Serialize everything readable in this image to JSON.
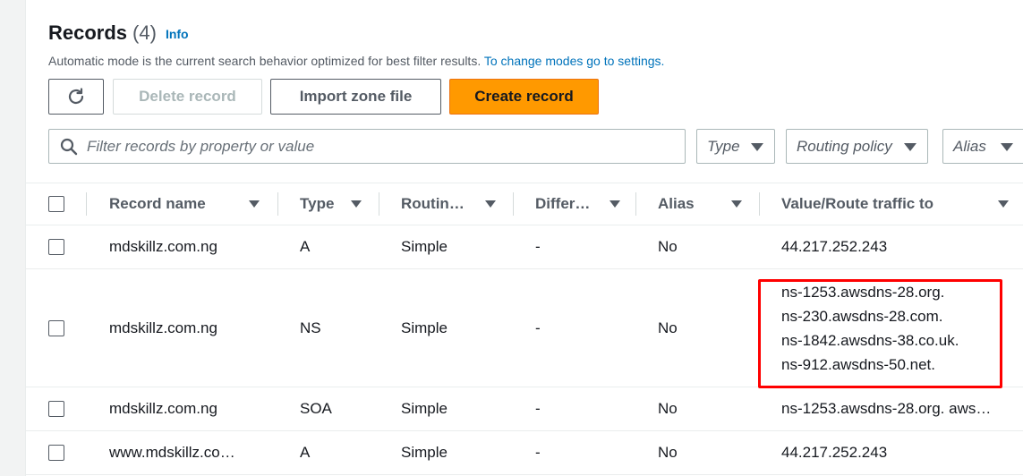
{
  "header": {
    "title": "Records",
    "count": "(4)",
    "info_link": "Info",
    "description": "Automatic mode is the current search behavior optimized for best filter results.",
    "description_link": "To change modes go to settings."
  },
  "toolbar": {
    "delete_label": "Delete record",
    "import_label": "Import zone file",
    "create_label": "Create record"
  },
  "search": {
    "placeholder": "Filter records by property or value"
  },
  "filters": {
    "type": "Type",
    "routing_policy": "Routing policy",
    "alias": "Alias"
  },
  "table": {
    "columns": {
      "record_name": "Record name",
      "type": "Type",
      "routing": "Routin…",
      "differentiator": "Differ…",
      "alias": "Alias",
      "value": "Value/Route traffic to"
    },
    "rows": [
      {
        "name": "mdskillz.com.ng",
        "type": "A",
        "routing": "Simple",
        "diff": "-",
        "alias": "No",
        "value": "44.217.252.243"
      },
      {
        "name": "mdskillz.com.ng",
        "type": "NS",
        "routing": "Simple",
        "diff": "-",
        "alias": "No",
        "values": [
          "ns-1253.awsdns-28.org.",
          "ns-230.awsdns-28.com.",
          "ns-1842.awsdns-38.co.uk.",
          "ns-912.awsdns-50.net."
        ]
      },
      {
        "name": "mdskillz.com.ng",
        "type": "SOA",
        "routing": "Simple",
        "diff": "-",
        "alias": "No",
        "value": "ns-1253.awsdns-28.org. aws…"
      },
      {
        "name": "www.mdskillz.co…",
        "type": "A",
        "routing": "Simple",
        "diff": "-",
        "alias": "No",
        "value": "44.217.252.243"
      }
    ]
  },
  "colors": {
    "accent_link": "#0073bb",
    "primary_button": "#ff9900",
    "highlight_box": "#ff0000"
  }
}
